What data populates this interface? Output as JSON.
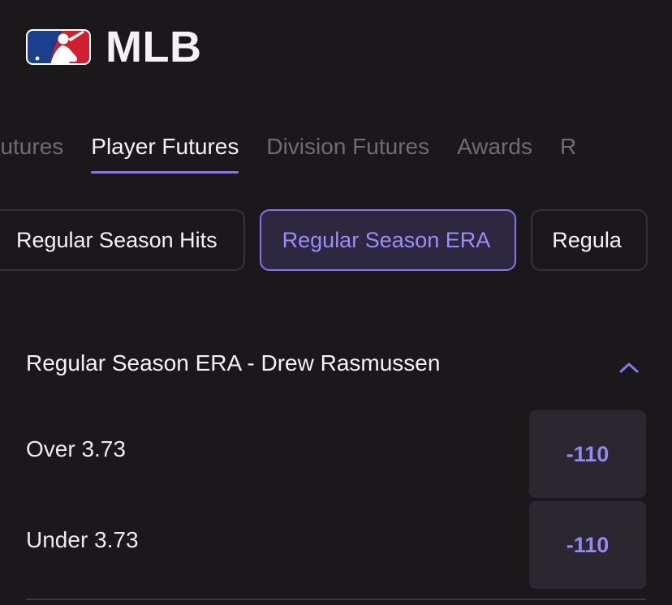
{
  "header": {
    "title": "MLB",
    "logo_icon": "mlb-logo-icon",
    "logo_colors": {
      "left": "#1b3f8c",
      "right": "#d21f2f",
      "figure": "#ffffff"
    }
  },
  "tabs": [
    {
      "label": "n Futures",
      "active": false
    },
    {
      "label": "Player Futures",
      "active": true
    },
    {
      "label": "Division Futures",
      "active": false
    },
    {
      "label": "Awards",
      "active": false
    },
    {
      "label": "R",
      "active": false
    }
  ],
  "chips": [
    {
      "label": "Regular Season Hits",
      "active": false
    },
    {
      "label": "Regular Season ERA",
      "active": true
    },
    {
      "label": "Regula",
      "active": false
    }
  ],
  "market": {
    "title": "Regular Season ERA - Drew Rasmussen",
    "collapse_icon": "chevron-up-icon",
    "outcomes": [
      {
        "label": "Over 3.73",
        "odds": "-110"
      },
      {
        "label": "Under 3.73",
        "odds": "-110"
      }
    ]
  },
  "colors": {
    "background": "#1b181c",
    "accent": "#8a73f0",
    "odds_text": "#9a86f3",
    "muted_text": "#6f6b75"
  }
}
